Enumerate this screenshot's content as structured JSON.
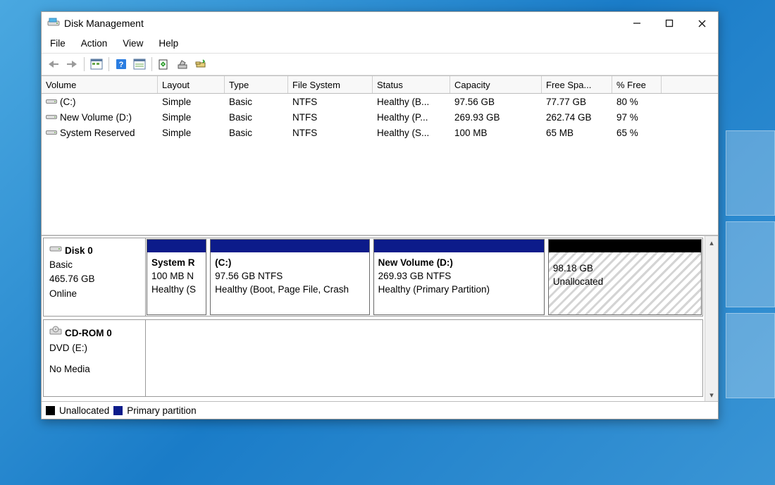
{
  "window": {
    "title": "Disk Management"
  },
  "menu": {
    "file": "File",
    "action": "Action",
    "view": "View",
    "help": "Help"
  },
  "columns": {
    "volume": "Volume",
    "layout": "Layout",
    "type": "Type",
    "fs": "File System",
    "status": "Status",
    "capacity": "Capacity",
    "free": "Free Spa...",
    "pct": "% Free"
  },
  "volumes": [
    {
      "name": "(C:)",
      "layout": "Simple",
      "type": "Basic",
      "fs": "NTFS",
      "status": "Healthy (B...",
      "capacity": "97.56 GB",
      "free": "77.77 GB",
      "pct": "80 %"
    },
    {
      "name": "New Volume (D:)",
      "layout": "Simple",
      "type": "Basic",
      "fs": "NTFS",
      "status": "Healthy (P...",
      "capacity": "269.93 GB",
      "free": "262.74 GB",
      "pct": "97 %"
    },
    {
      "name": "System Reserved",
      "layout": "Simple",
      "type": "Basic",
      "fs": "NTFS",
      "status": "Healthy (S...",
      "capacity": "100 MB",
      "free": "65 MB",
      "pct": "65 %"
    }
  ],
  "disk0": {
    "name": "Disk 0",
    "type": "Basic",
    "size": "465.76 GB",
    "state": "Online",
    "parts": [
      {
        "title": "System R",
        "line1": "100 MB N",
        "line2": "Healthy (S",
        "kind": "primary",
        "flex": 10
      },
      {
        "title": " (C:)",
        "line1": "97.56 GB NTFS",
        "line2": "Healthy (Boot, Page File, Crash",
        "kind": "primary",
        "flex": 27
      },
      {
        "title": "New Volume  (D:)",
        "line1": "269.93 GB NTFS",
        "line2": "Healthy (Primary Partition)",
        "kind": "primary",
        "flex": 29
      },
      {
        "title": "",
        "line1": "98.18 GB",
        "line2": "Unallocated",
        "kind": "unalloc",
        "flex": 26
      }
    ]
  },
  "cdrom": {
    "name": "CD-ROM 0",
    "type": "DVD (E:)",
    "state": "No Media"
  },
  "legend": {
    "unallocated": "Unallocated",
    "primary": "Primary partition"
  }
}
